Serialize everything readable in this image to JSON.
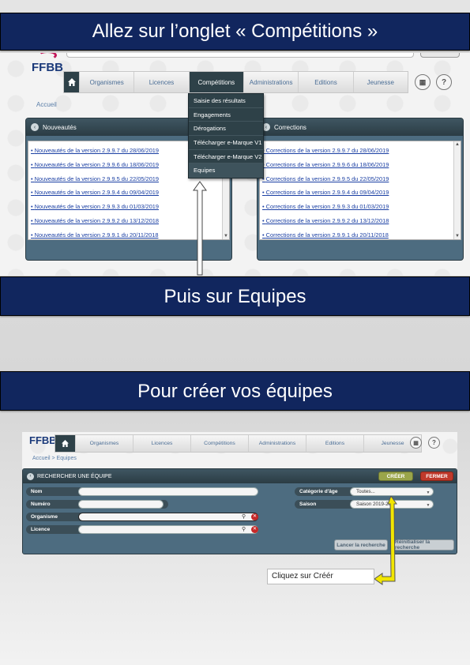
{
  "banners": {
    "top": "Allez sur l’onglet « Compétitions »",
    "middle": "Puis sur Equipes",
    "lower": "Pour créer vos équipes"
  },
  "logo": "FFBB",
  "nav": {
    "tabs": [
      "Organismes",
      "Licences",
      "Compétitions",
      "Administrations",
      "Editions",
      "Jeunesse"
    ],
    "active": "Compétitions",
    "help_label": "?"
  },
  "screenshot1": {
    "breadcrumb": "Accueil",
    "dropdown": [
      "Saisie des résultats",
      "Engagements",
      "Dérogations",
      "Télécharger e-Marque V1",
      "Télécharger e-Marque V2",
      "Equipes"
    ],
    "news_panel": {
      "title": "Nouveautés",
      "items": [
        "Nouveautés de la version 2.9.9.7 du 28/06/2019",
        "Nouveautés de la version 2.9.9.6 du 18/06/2019",
        "Nouveautés de la version 2.9.9.5 du 22/05/2019",
        "Nouveautés de la version 2.9.9.4 du 09/04/2019",
        "Nouveautés de la version 2.9.9.3 du 01/03/2019",
        "Nouveautés de la version 2.9.9.2 du 13/12/2018",
        "Nouveautés de la version 2.9.9.1 du 20/11/2018"
      ]
    },
    "corrections_panel": {
      "title": "Corrections",
      "items": [
        "Corrections de la version 2.9.9.7 du 28/06/2019",
        "Corrections de la version 2.9.9.6 du 18/06/2019",
        "Corrections de la version 2.9.9.5 du 22/05/2019",
        "Corrections de la version 2.9.9.4 du 09/04/2019",
        "Corrections de la version 2.9.9.3 du 01/03/2019",
        "Corrections de la version 2.9.9.2 du 13/12/2018",
        "Corrections de la version 2.9.9.1 du 20/11/2018"
      ]
    }
  },
  "screenshot2": {
    "breadcrumb": "Accueil > Equipes",
    "panel_title": "RECHERCHER UNE ÉQUIPE",
    "create_button": "CRÉER",
    "close_button": "FERMER",
    "fields": {
      "nom": "Nom",
      "numero": "Numéro",
      "organisme": "Organisme",
      "licence": "Licence",
      "categorie_label": "Catégorie d'âge",
      "categorie_value": "Toutes...",
      "saison_label": "Saison",
      "saison_value": "Saison 2019-20"
    },
    "search_button": "Lancer la recherche",
    "reset_button": "Réinitialiser la recherche"
  },
  "callout": "Cliquez sur Créér",
  "colors": {
    "banner_bg": "#11265e",
    "nav_dark": "#2e4148",
    "panel_bg": "#4d6c80",
    "link": "#1a3fa3",
    "create_btn": "#9aa54a",
    "close_btn": "#c0392b",
    "arrow_yellow": "#f2e600"
  },
  "icons": [
    "home-icon",
    "circle-arrow-icon",
    "search-icon",
    "clear-x-icon",
    "dropdown-caret-icon",
    "scroll-up-icon",
    "scroll-down-icon"
  ]
}
